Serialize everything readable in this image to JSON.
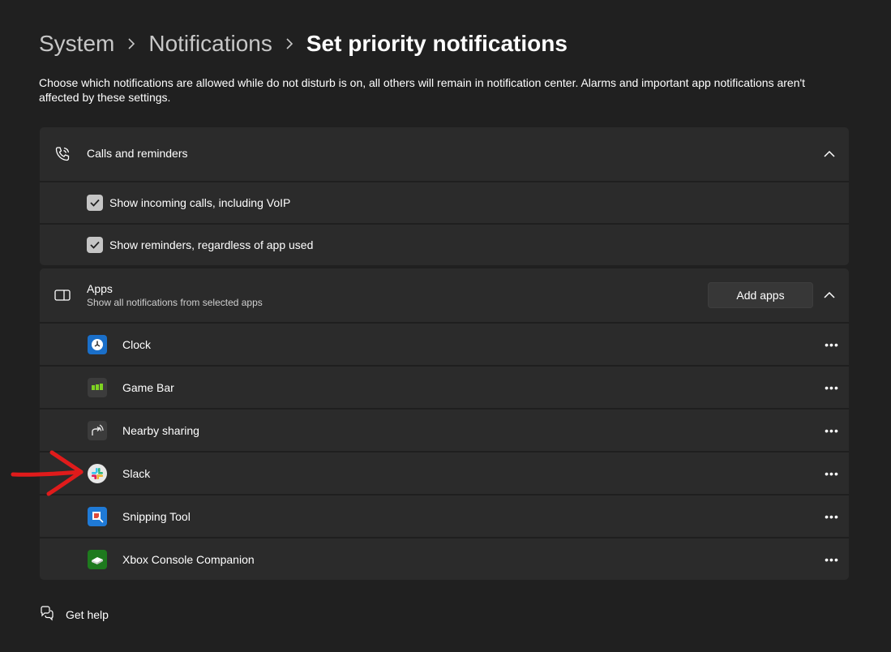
{
  "breadcrumb": {
    "items": [
      "System",
      "Notifications",
      "Set priority notifications"
    ]
  },
  "intro": "Choose which notifications are allowed while do not disturb is on, all others will remain in notification center. Alarms and important app notifications aren't affected by these settings.",
  "calls_section": {
    "title": "Calls and reminders",
    "icon": "phone-icon",
    "expanded": true,
    "options": [
      {
        "label": "Show incoming calls, including VoIP",
        "checked": true
      },
      {
        "label": "Show reminders, regardless of app used",
        "checked": true
      }
    ]
  },
  "apps_section": {
    "title": "Apps",
    "subtitle": "Show all notifications from selected apps",
    "icon": "apps-icon",
    "add_button": "Add apps",
    "expanded": true,
    "apps": [
      {
        "name": "Clock",
        "icon": "clock-icon"
      },
      {
        "name": "Game Bar",
        "icon": "game-bar-icon"
      },
      {
        "name": "Nearby sharing",
        "icon": "nearby-sharing-icon"
      },
      {
        "name": "Slack",
        "icon": "slack-icon"
      },
      {
        "name": "Snipping Tool",
        "icon": "snipping-tool-icon"
      },
      {
        "name": "Xbox Console Companion",
        "icon": "xbox-icon"
      }
    ],
    "more_glyph": "•••"
  },
  "footer": {
    "get_help": "Get help"
  },
  "colors": {
    "background": "#202020",
    "card": "#2b2b2b",
    "annotation_arrow": "#e01b1b"
  }
}
